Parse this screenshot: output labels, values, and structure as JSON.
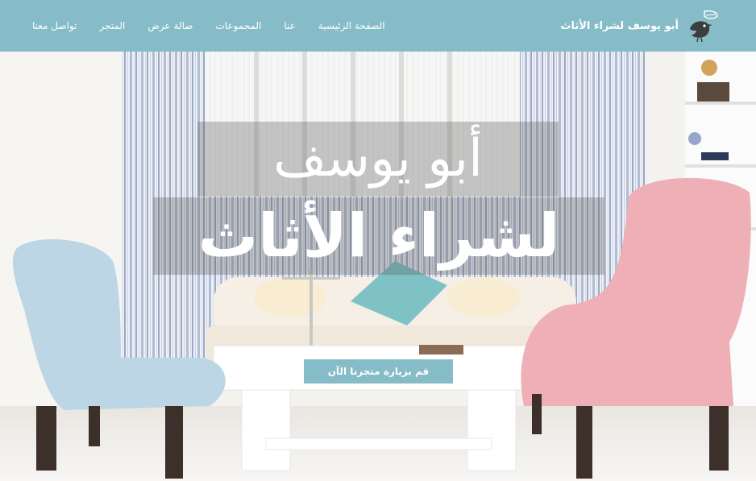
{
  "brand": {
    "name": "أبو يوسف لشراء الأثاث"
  },
  "nav": {
    "items": [
      {
        "label": "الصفحة الرئيسية"
      },
      {
        "label": "عنا"
      },
      {
        "label": "المجموعات"
      },
      {
        "label": "صالة عرض"
      },
      {
        "label": "المتجر"
      },
      {
        "label": "تواصل معنا"
      }
    ]
  },
  "hero": {
    "title_line_1": "أبو يوسف",
    "title_line_2": "لشراء الأثاث",
    "cta_label": "قم بزيارة متجرنا الآن"
  },
  "colors": {
    "header": "#86bcc7",
    "cta": "#86bcc7",
    "text": "#ffffff"
  }
}
